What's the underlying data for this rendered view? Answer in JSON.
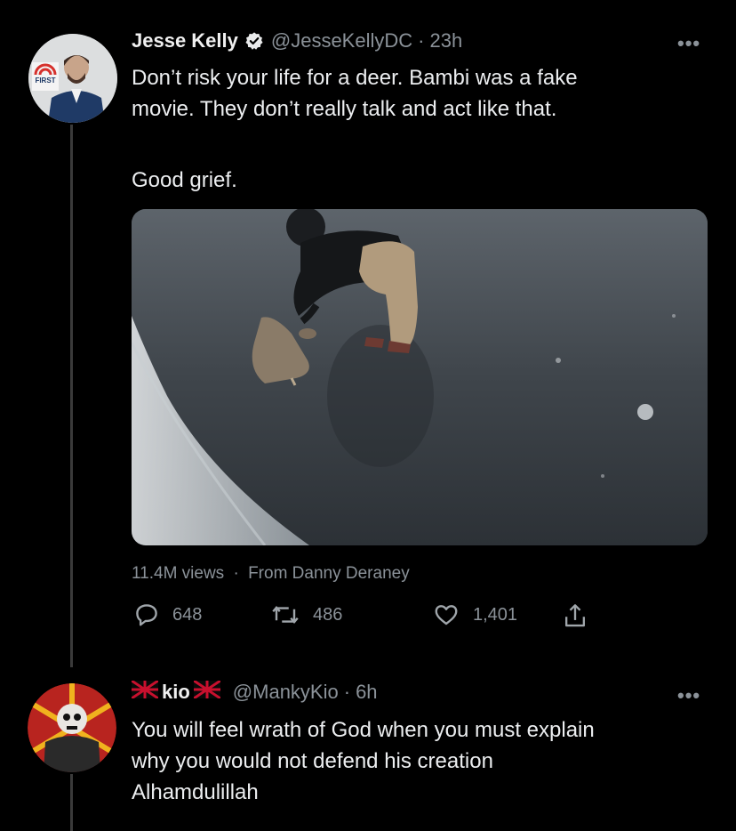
{
  "tweet": {
    "author_name": "Jesse Kelly",
    "author_handle": "@JesseKellyDC",
    "separator": "·",
    "time": "23h",
    "more": "•••",
    "text_lines": [
      "Don’t risk your life for a deer. Bambi was a fake",
      "movie. They don’t really talk and act like that."
    ],
    "text_line_last": "Good grief.",
    "avatar_badge_text": "FIRST",
    "views": "11.4M views",
    "source": "From Danny Deraney",
    "replies": "648",
    "retweets": "486",
    "likes": "1,401"
  },
  "reply": {
    "author_name": "kio",
    "author_handle": "@MankyKio",
    "separator": "·",
    "time": "6h",
    "more": "•••",
    "text_lines": [
      "You will feel wrath of God when you must explain",
      "why you would not defend his creation",
      "Alhamdulillah"
    ]
  },
  "icons": [
    "verified-badge-icon",
    "reply-icon",
    "retweet-icon",
    "like-icon",
    "share-icon",
    "flag-icon"
  ],
  "colors": {
    "background": "#000000",
    "text": "#e7e9ea",
    "secondary_text": "#8b9299",
    "thread_line": "#3a3a3a"
  }
}
